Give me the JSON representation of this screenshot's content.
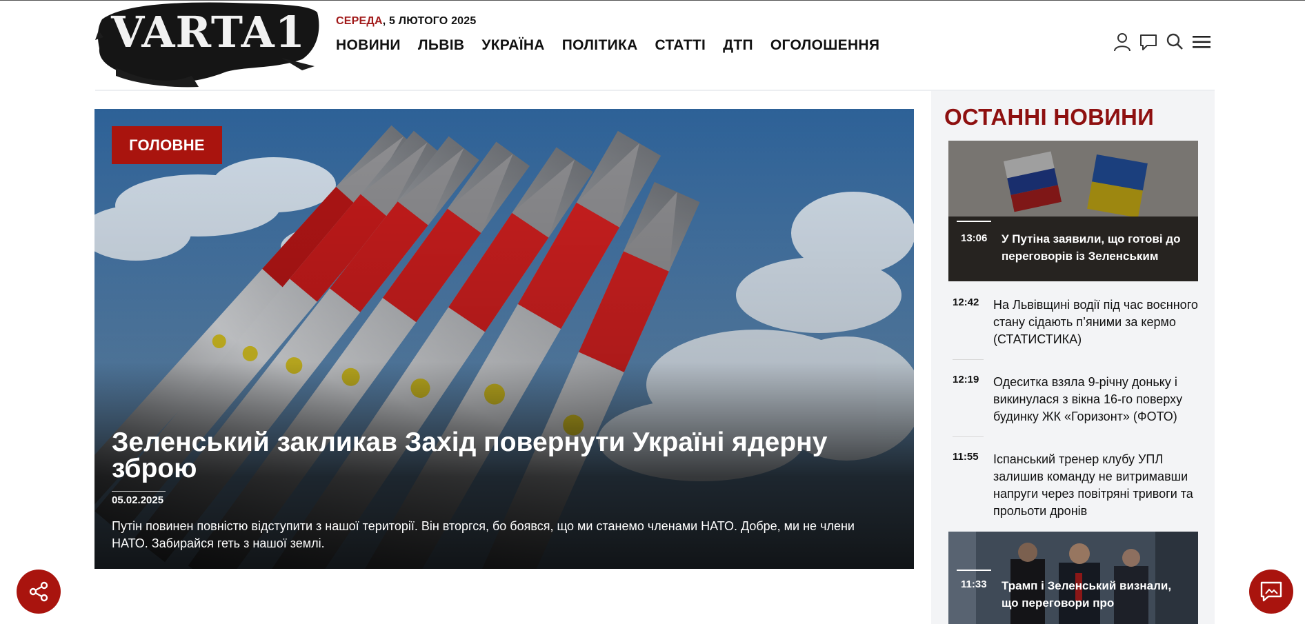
{
  "header": {
    "logo_text": "VARTA1",
    "date_day": "СЕРЕДА",
    "date_rest": ", 5 ЛЮТОГО 2025",
    "nav": [
      "НОВИНИ",
      "ЛЬВІВ",
      "УКРАЇНА",
      "ПОЛІТИКА",
      "СТАТТІ",
      "ДТП",
      "ОГОЛОШЕННЯ"
    ],
    "icons": [
      "user-icon",
      "comments-icon",
      "search-icon",
      "menu-icon"
    ]
  },
  "hero": {
    "badge": "ГОЛОВНЕ",
    "title": "Зеленський закликав Захід повернути Україні ядерну зброю",
    "date": "05.02.2025",
    "lead": "Путін повинен повністю відступити з нашої території. Він вторгся, бо боявся, що ми станемо членами НАТО. Добре, ми не члени НАТО. Забирайся геть з нашої землі."
  },
  "sidebar": {
    "title": "ОСТАННІ НОВИНИ",
    "news": [
      {
        "time": "13:06",
        "title": "У Путіна заявили, що готові до переговорів із Зеленським"
      },
      {
        "time": "12:42",
        "title": "На Львівщині водії під час воєнного стану сідають п’яними за кермо (СТАТИСТИКА)"
      },
      {
        "time": "12:19",
        "title": "Одеситка взяла 9-річну доньку і викинулася з вікна 16-го поверху будинку ЖК «Горизонт» (ФОТО)"
      },
      {
        "time": "11:55",
        "title": "Іспанський тренер клубу УПЛ залишив команду не витримавши напруги через повітряні тривоги та прольоти дронів"
      },
      {
        "time": "11:33",
        "title": "Трамп і Зеленський визнали, що переговори про"
      }
    ]
  },
  "floating": {
    "share_icon": "share-icon",
    "chat_icon": "chat-icon"
  },
  "colors": {
    "accent": "#a9140e",
    "title_red": "#8e1010",
    "sidebar_bg": "#f3f4f6"
  }
}
